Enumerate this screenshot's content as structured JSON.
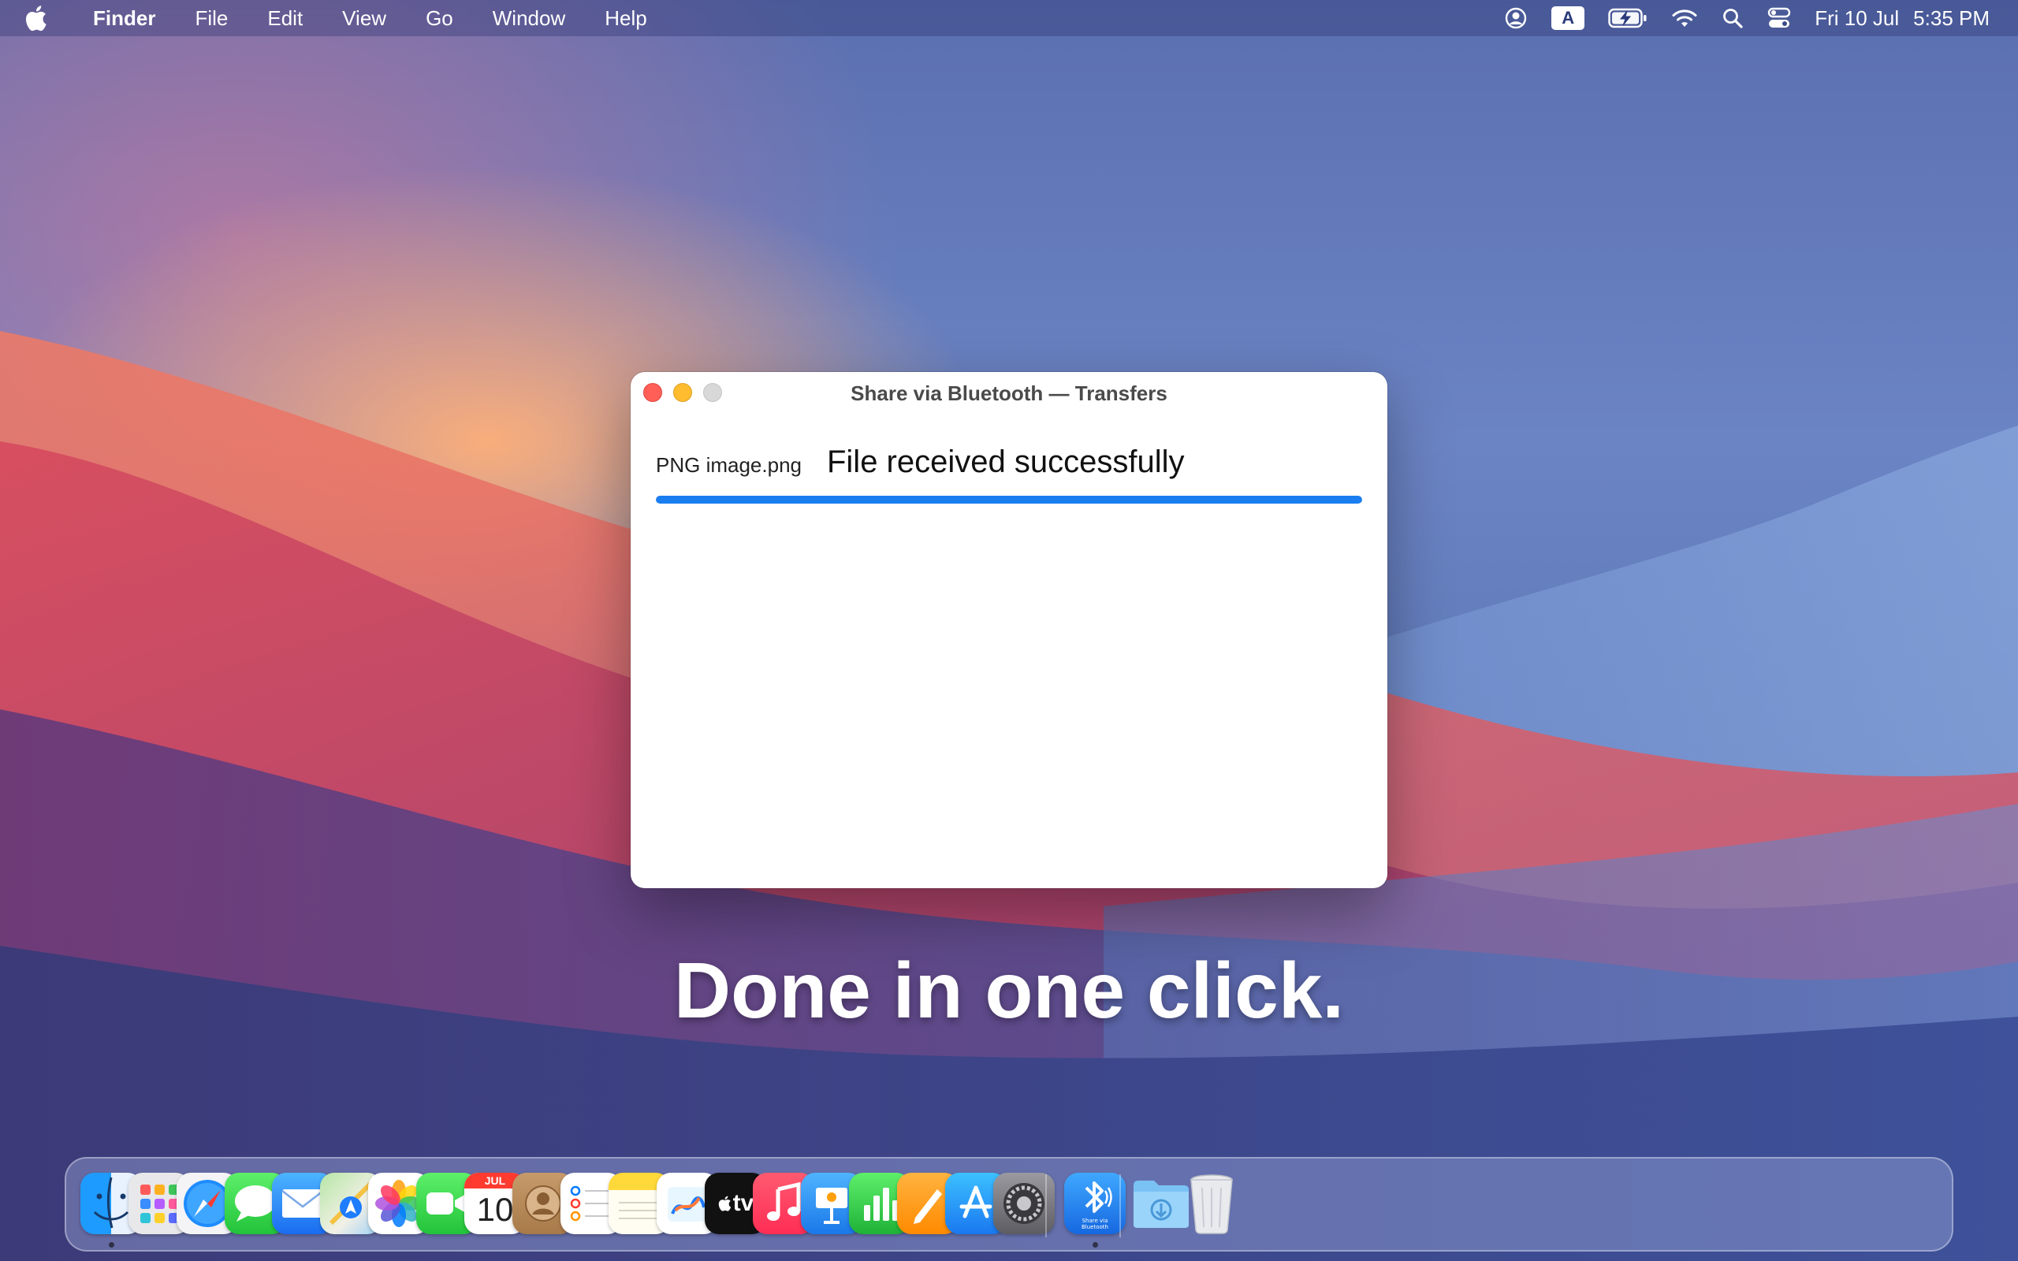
{
  "menubar": {
    "app_name": "Finder",
    "items": [
      "File",
      "Edit",
      "View",
      "Go",
      "Window",
      "Help"
    ],
    "input_indicator": "A",
    "date": "Fri 10 Jul",
    "time": "5:35 PM",
    "status_icons": [
      "user-icon",
      "input-source-icon",
      "battery-charging-icon",
      "wifi-icon",
      "spotlight-icon",
      "control-center-icon"
    ]
  },
  "window": {
    "title": "Share via Bluetooth — Transfers",
    "transfer": {
      "filename": "PNG image.png",
      "status": "File received successfully",
      "progress": 1.0
    }
  },
  "caption": "Done in one click.",
  "dock": {
    "apps": [
      {
        "name": "finder",
        "running": true
      },
      {
        "name": "launchpad",
        "running": false
      },
      {
        "name": "safari",
        "running": false
      },
      {
        "name": "messages",
        "running": false
      },
      {
        "name": "mail",
        "running": false
      },
      {
        "name": "maps",
        "running": false
      },
      {
        "name": "photos",
        "running": false
      },
      {
        "name": "facetime",
        "running": false
      },
      {
        "name": "calendar",
        "running": false,
        "month": "JUL",
        "day": "10"
      },
      {
        "name": "contacts",
        "running": false
      },
      {
        "name": "reminders",
        "running": false
      },
      {
        "name": "notes",
        "running": false
      },
      {
        "name": "freeform",
        "running": false
      },
      {
        "name": "apple-tv",
        "running": false,
        "label": "tv"
      },
      {
        "name": "music",
        "running": false
      },
      {
        "name": "keynote",
        "running": false
      },
      {
        "name": "numbers",
        "running": false
      },
      {
        "name": "pages",
        "running": false
      },
      {
        "name": "app-store",
        "running": false
      },
      {
        "name": "system-settings",
        "running": false
      },
      {
        "name": "share-via-bluetooth",
        "running": true,
        "label": "Share via Bluetooth"
      },
      {
        "name": "downloads-folder",
        "running": false
      },
      {
        "name": "trash",
        "running": false
      }
    ]
  },
  "colors": {
    "accent": "#1a7ef0",
    "close": "#ff5f57",
    "minimize": "#febc2e",
    "zoom": "#d8d8d8"
  }
}
